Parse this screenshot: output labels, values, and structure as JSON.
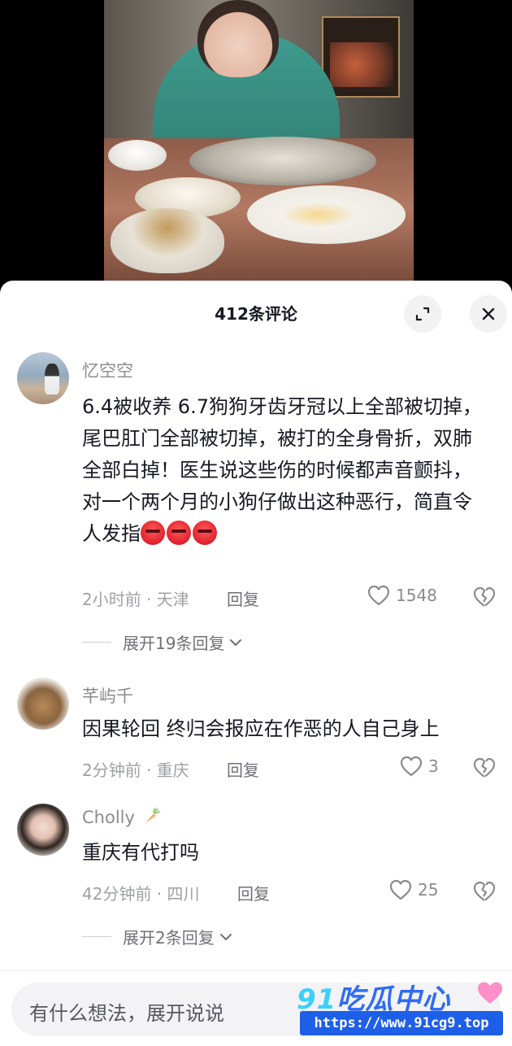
{
  "sheet": {
    "title": "412条评论"
  },
  "comments": [
    {
      "username": "忆空空",
      "text": "6.4被收养 6.7狗狗牙齿牙冠以上全部被切掉，尾巴肛门全部被切掉，被打的全身骨折，双肺全部白掉！医生说这些伤的时候都声音颤抖，对一个两个月的小狗仔做出这种恶行，简直令人发指",
      "emoji": "angry-face x3",
      "meta": "2小时前 · 天津",
      "reply_label": "回复",
      "likes": "1548",
      "expand_replies": "展开19条回复"
    },
    {
      "username": "芊屿千",
      "text": "因果轮回 终归会报应在作恶的人自己身上",
      "meta": "2分钟前 · 重庆",
      "reply_label": "回复",
      "likes": "3"
    },
    {
      "username": "Cholly",
      "username_icon": "carrot-icon",
      "text": "重庆有代打吗",
      "meta": "42分钟前 · 四川",
      "reply_label": "回复",
      "likes": "25",
      "expand_replies": "展开2条回复"
    }
  ],
  "input": {
    "placeholder": "有什么想法，展开说说"
  },
  "watermark": {
    "prefix": "91",
    "title": "吃瓜中心",
    "url": "https://www.91cg9.top"
  },
  "colors": {
    "text_primary": "#161823",
    "text_secondary": "#8a8b91",
    "watermark_blue": "#1e5fe8"
  }
}
